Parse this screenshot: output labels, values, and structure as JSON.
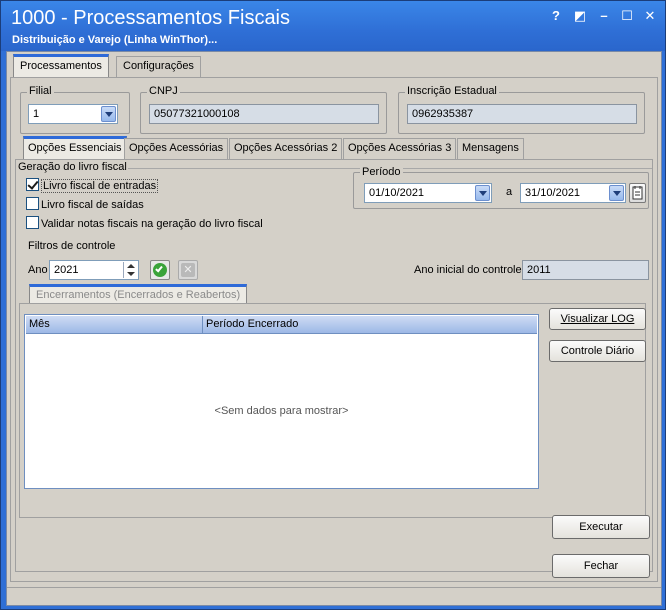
{
  "window": {
    "title": "1000 - Processamentos Fiscais",
    "subtitle": "Distribuição e Varejo (Linha WinThor)...",
    "controls": {
      "help": "?",
      "restore": "◩",
      "minimize": "–",
      "maximize": "☐",
      "close": "✕"
    }
  },
  "main_tabs": {
    "processamentos": "Processamentos",
    "configuracoes": "Configurações"
  },
  "filial": {
    "label": "Filial",
    "value": "1"
  },
  "cnpj": {
    "label": "CNPJ",
    "value": "05077321000108"
  },
  "inscricao": {
    "label": "Inscrição Estadual",
    "value": "0962935387"
  },
  "sub_tabs": {
    "essenciais": "Opções Essenciais",
    "acessorias": "Opções Acessórias",
    "acessorias2": "Opções Acessórias 2",
    "acessorias3": "Opções Acessórias 3",
    "mensagens": "Mensagens"
  },
  "geracao": {
    "title": "Geração do livro fiscal",
    "entradas": "Livro fiscal de entradas",
    "saidas": "Livro fiscal de saídas",
    "validar": "Validar notas fiscais na geração do livro fiscal",
    "entradas_checked": true,
    "saidas_checked": false,
    "validar_checked": false
  },
  "periodo": {
    "label": "Período",
    "start": "01/10/2021",
    "separator": "a",
    "end": "31/10/2021"
  },
  "filtros": {
    "title": "Filtros de controle",
    "ano_label": "Ano",
    "ano_value": "2021",
    "ano_inicial_label": "Ano inicial do controle",
    "ano_inicial_value": "2011"
  },
  "encerramentos": {
    "tab": "Encerramentos (Encerrados e Reabertos)",
    "columns": [
      "Mês",
      "Período Encerrado"
    ],
    "empty": "<Sem dados para mostrar>",
    "visualizar_log": "Visualizar LOG",
    "controle_diario": "Controle Diário"
  },
  "buttons": {
    "executar": "Executar",
    "fechar": "Fechar"
  },
  "colors": {
    "accent": "#2e6ad8",
    "confirm": "#3aa33a",
    "titlebar": "#2f6fd6"
  }
}
